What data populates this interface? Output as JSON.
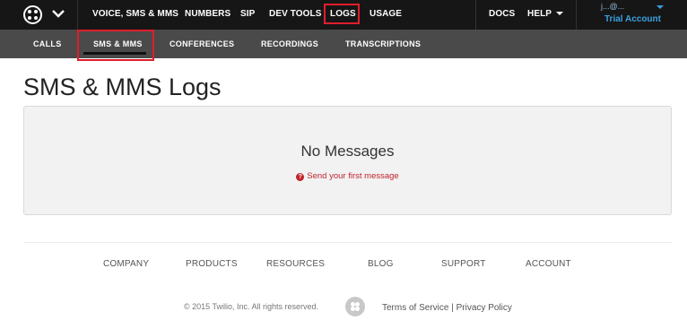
{
  "topnav": {
    "items": [
      {
        "label": "VOICE, SMS & MMS"
      },
      {
        "label": "NUMBERS"
      },
      {
        "label": "SIP"
      },
      {
        "label": "DEV TOOLS"
      },
      {
        "label": "LOGS"
      },
      {
        "label": "USAGE"
      }
    ],
    "docs_label": "DOCS",
    "help_label": "HELP",
    "account": {
      "email": "j...@...",
      "plan": "Trial Account"
    }
  },
  "subnav": {
    "items": [
      {
        "label": "CALLS"
      },
      {
        "label": "SMS & MMS"
      },
      {
        "label": "CONFERENCES"
      },
      {
        "label": "RECORDINGS"
      },
      {
        "label": "TRANSCRIPTIONS"
      }
    ],
    "active": "SMS & MMS"
  },
  "page": {
    "title": "SMS & MMS Logs"
  },
  "empty_state": {
    "title": "No Messages",
    "link_label": "Send your first message"
  },
  "footer": {
    "links": [
      "COMPANY",
      "PRODUCTS",
      "RESOURCES",
      "BLOG",
      "SUPPORT",
      "ACCOUNT"
    ],
    "copyright": "© 2015 Twilio, Inc. All rights reserved.",
    "terms": "Terms of Service",
    "separator": "|",
    "privacy": "Privacy Policy"
  },
  "colors": {
    "topnav_bg": "#161616",
    "subnav_bg": "#4a4a4a",
    "highlight_red": "#e01e2b",
    "link_red": "#c0242b",
    "account_blue": "#3aa0e0"
  }
}
